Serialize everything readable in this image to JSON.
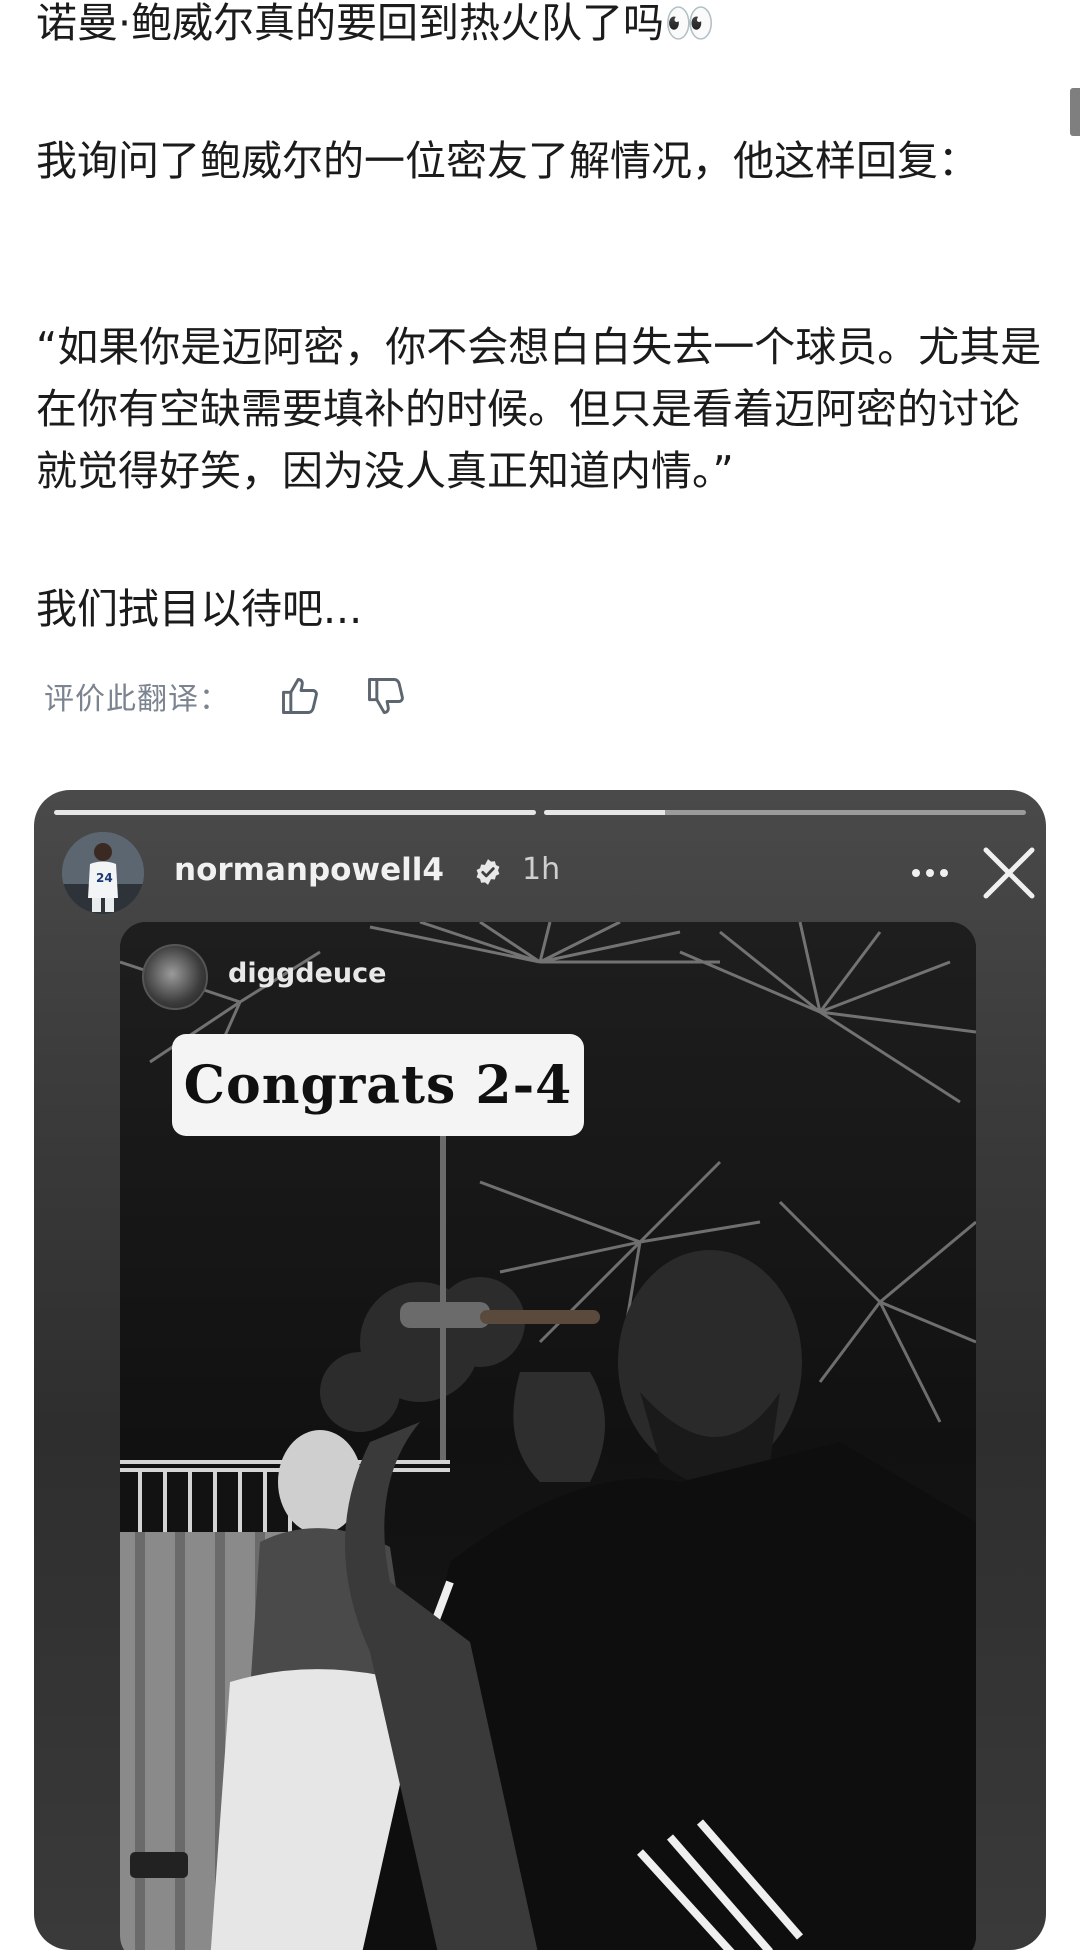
{
  "post": {
    "line1": "诺曼·鲍威尔真的要回到热火队了吗👀",
    "line2": "我询问了鲍威尔的一位密友了解情况，他这样回复：",
    "line3": "“如果你是迈阿密，你不会想白白失去一个球员。尤其是在你有空缺需要填补的时候。但只是看着迈阿密的讨论就觉得好笑，因为没人真正知道内情。”",
    "line4": "我们拭目以待吧..."
  },
  "rating": {
    "label": "评价此翻译：",
    "thumbs_up_icon": "thumbs-up-icon",
    "thumbs_down_icon": "thumbs-down-icon"
  },
  "story": {
    "progress": [
      1.0,
      0.25
    ],
    "username": "normanpowell4",
    "time": "1h",
    "verified_icon": "verified-badge-icon",
    "more_icon": "more-dots-icon",
    "close_icon": "close-icon",
    "shared_post": {
      "username": "diggdeuce",
      "sticker_text": "Congrats 2-4"
    }
  },
  "colors": {
    "text": "#1b1b1b",
    "rating_label": "#7b8490",
    "story_bg": "#3d3d3d"
  }
}
